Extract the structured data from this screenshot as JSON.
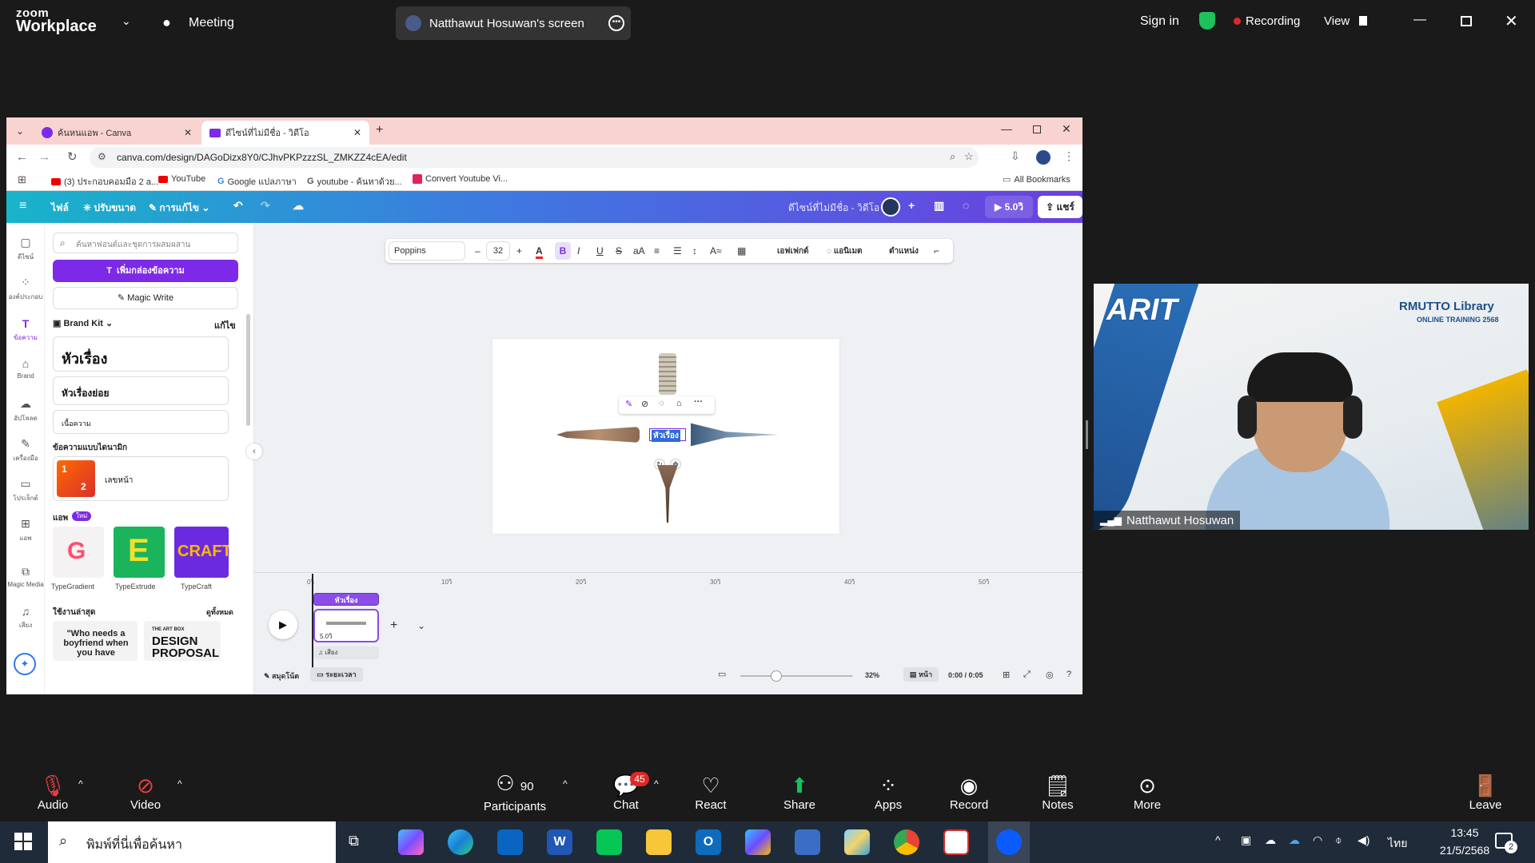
{
  "zoom_top": {
    "logo_small": "zoom",
    "logo_big": "Workplace",
    "meeting_label": "Meeting",
    "share_banner": "Natthawut Hosuwan's screen",
    "sign_in": "Sign in",
    "recording": "Recording",
    "view": "View"
  },
  "browser": {
    "tabs": [
      {
        "label": "ค้นหนแอพ - Canva"
      },
      {
        "label": "ดีไซน์ที่ไม่มีชื่อ - วิดีโอ"
      }
    ],
    "url": "canva.com/design/DAGoDizx8Y0/CJhvPKPzzzSL_ZMKZZ4cEA/edit",
    "bookmarks": [
      "(3) ประกอบคอมมือ 2 a...",
      "YouTube",
      "Google แปลภาษา",
      "youtube - ค้นหาด้วย...",
      "Convert Youtube Vi..."
    ],
    "all_bookmarks": "All Bookmarks"
  },
  "canva": {
    "menu": [
      "ไฟล์",
      "ปรับขนาด",
      "การแก้ไข"
    ],
    "design_title": "ดีไซน์ที่ไม่มีชื่อ - วิดีโอ",
    "play_duration": "5.0วิ",
    "share": "แชร์",
    "rail": [
      "ดีไซน์",
      "องค์ประกอบ",
      "ข้อความ",
      "Brand",
      "อัปโหลด",
      "เครื่องมือ",
      "โปรเจ็กต์",
      "แอพ",
      "Magic Media",
      "เสียง"
    ],
    "search_placeholder": "ค้นหาฟอนต์และชุดการผสมผสาน",
    "add_text_button": "เพิ่มกล่องข้อความ",
    "magic_write": "Magic Write",
    "brand_kit": "Brand Kit",
    "edit": "แก้ไข",
    "heading": "หัวเรื่อง",
    "subheading": "หัวเรื่องย่อย",
    "body": "เนื้อความ",
    "dynamic_text": "ข้อความแบบไดนามิก",
    "page_number": "เลขหน้า",
    "apps_label": "แอพ",
    "new_badge": "ใหม่",
    "apps": [
      "TypeGradient",
      "TypeExtrude",
      "TypeCraft"
    ],
    "recent_label": "ใช้งานล่าสุด",
    "see_all": "ดูทั้งหมด",
    "recent_1": "\"Who needs a boyfriend when you have",
    "recent_2_small": "THE ART BOX",
    "recent_2": "DESIGN PROPOSAL",
    "font": "Poppins",
    "font_size": "32",
    "effects": "เอฟเฟกต์",
    "animate": "แอนิเมต",
    "position": "ตำแหน่ง",
    "selected_text": "หัวเรื่อง",
    "timeline_ticks": [
      "0วิ",
      "10วิ",
      "20วิ",
      "30วิ",
      "40วิ",
      "50วิ"
    ],
    "clip_label": "หัวเรื่อง",
    "clip_duration": "5.0วิ",
    "audio": "เสียง",
    "notes": "สมุดโน้ต",
    "duration_btn": "ระยะเวลา",
    "zoom_pct": "32%",
    "pages": "หน้า",
    "time": "0:00 / 0:05"
  },
  "video": {
    "logo": "ARIT",
    "lib": "RMUTTO Library",
    "lib_sub": "ONLINE TRAINING 2568",
    "name": "Natthawut Hosuwan"
  },
  "zoom_bottom": {
    "audio": "Audio",
    "video": "Video",
    "participants": "Participants",
    "participants_count": "90",
    "chat": "Chat",
    "chat_badge": "45",
    "react": "React",
    "share": "Share",
    "apps": "Apps",
    "record": "Record",
    "notes": "Notes",
    "more": "More",
    "leave": "Leave"
  },
  "taskbar": {
    "search_placeholder": "พิมพ์ที่นี่เพื่อค้นหา",
    "lang": "ไทย",
    "time": "13:45",
    "date": "21/5/2568",
    "notif": "2"
  },
  "colors": {
    "canva_purple": "#7d2ae8",
    "zoom_share_green": "#16c15b",
    "recording_red": "#e02828"
  }
}
